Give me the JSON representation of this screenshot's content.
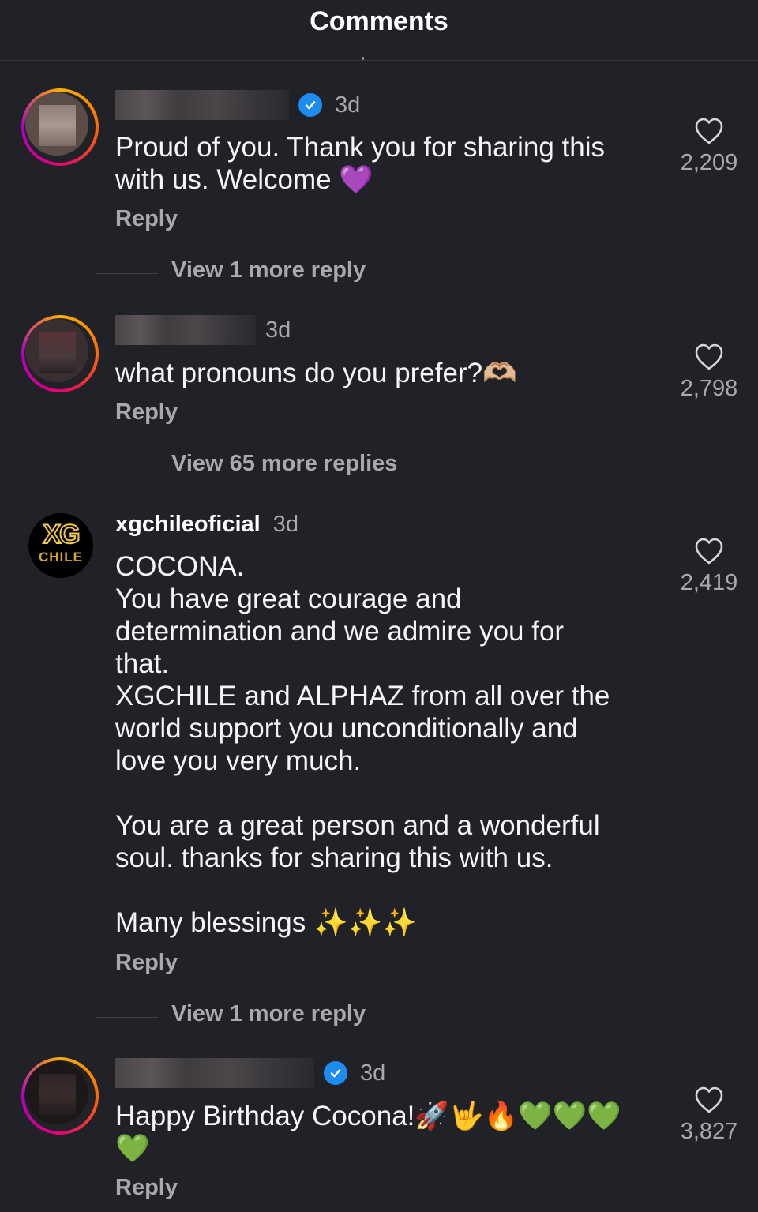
{
  "header": {
    "title": "Comments"
  },
  "comments": [
    {
      "username": "",
      "time": "3d",
      "text": "Proud of you. Thank you for sharing this\nwith us. Welcome 💜",
      "reply": "Reply",
      "likes": "2,209",
      "view_more": "View 1 more reply",
      "verified": true
    },
    {
      "username": "",
      "time": "3d",
      "text": "what pronouns do you prefer?🫶🏼",
      "reply": "Reply",
      "likes": "2,798",
      "view_more": "View 65 more replies",
      "verified": false
    },
    {
      "username": "xgchileoficial",
      "time": "3d",
      "text": "COCONA.\nYou have great courage and\ndetermination and we admire you for\nthat.\nXGCHILE and ALPHAZ from all over the\nworld support you unconditionally and\nlove you very much.\n\nYou are a great person and a wonderful\nsoul. thanks for sharing this with us.\n\nMany blessings ✨✨✨",
      "reply": "Reply",
      "likes": "2,419",
      "view_more": "View 1 more reply",
      "verified": false,
      "avatar_logo": "XG",
      "avatar_logo_sub": "CHILE"
    },
    {
      "username": "",
      "time": "3d",
      "text": "Happy Birthday Cocona!🚀🤟🔥💚💚💚\n💚",
      "reply": "Reply",
      "likes": "3,827",
      "verified": true
    }
  ]
}
